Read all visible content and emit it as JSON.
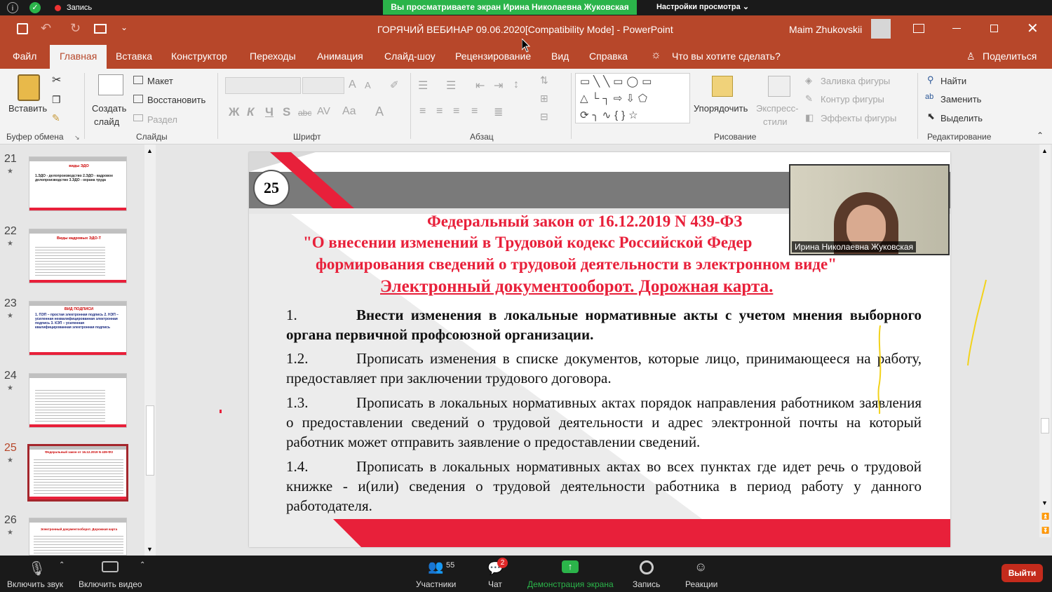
{
  "zoom_top": {
    "recording_label": "Запись",
    "share_banner": "Вы просматриваете экран Ирина Николаевна Жуковская",
    "view_options": "Настройки просмотра"
  },
  "titlebar": {
    "title": "ГОРЯЧИЙ ВЕБИНАР 09.06.2020[Compatibility Mode]  -  PowerPoint",
    "user": "Maim Zhukovskii"
  },
  "tabs": [
    "Файл",
    "Главная",
    "Вставка",
    "Конструктор",
    "Переходы",
    "Анимация",
    "Слайд-шоу",
    "Рецензирование",
    "Вид",
    "Справка"
  ],
  "tell_me": "Что вы хотите сделать?",
  "share": "Поделиться",
  "ribbon": {
    "paste": "Вставить",
    "clipboard_group": "Буфер обмена",
    "new_slide": "Создать",
    "new_slide2": "слайд",
    "layout": "Макет",
    "reset": "Восстановить",
    "section": "Раздел",
    "slides_group": "Слайды",
    "font_group": "Шрифт",
    "paragraph_group": "Абзац",
    "arrange": "Упорядочить",
    "quick_styles": "Экспресс-",
    "quick_styles2": "стили",
    "shape_fill": "Заливка фигуры",
    "shape_outline": "Контур фигуры",
    "shape_effects": "Эффекты фигуры",
    "drawing_group": "Рисование",
    "find": "Найти",
    "replace": "Заменить",
    "select": "Выделить",
    "editing_group": "Редактирование",
    "font_buttons": [
      "Ж",
      "К",
      "Ч",
      "S",
      "abc",
      "AV",
      "Aa",
      "A"
    ]
  },
  "thumbnails": [
    {
      "num": "21",
      "title": "виды ЭДО",
      "body": "1.ЭДО - делопроизводство 2.ЭДО - кадровое делопроизводство 3.ЭДО - охрана труда"
    },
    {
      "num": "22",
      "title": "Виды кадровых ЭДО-Т",
      "body": ""
    },
    {
      "num": "23",
      "title": "ВИД ПОДПИСИ",
      "body": "1. ПЭП – простая электронная подпись 2. НЭП – усиленная неквалифицированная электронная подпись 3. КЭП – усиленная квалифицированная электронная подпись"
    },
    {
      "num": "24",
      "title": "",
      "body": ""
    },
    {
      "num": "25",
      "title": "Федеральный закон от 16.12.2019 N 439-ФЗ",
      "body": ""
    },
    {
      "num": "26",
      "title": "Электронный документооборот. Дорожная карта",
      "body": ""
    }
  ],
  "slide": {
    "number": "25",
    "title1": "Федеральный закон от 16.12.2019 N 439-ФЗ",
    "title2": "\"О внесении изменений в Трудовой кодекс Российской Федер",
    "title3": "формирования сведений о трудовой деятельности в электронном виде\"",
    "title4": "Электронный документооборот. Дорожная карта.",
    "items": [
      {
        "num": "1.",
        "text": "Внести изменения в локальные нормативные акты с учетом мнения выборного органа первичной профсоюзной организации."
      },
      {
        "num": "1.2.",
        "text": "Прописать изменения в списке документов, которые лицо, принимающееся на работу, предоставляет при заключении трудового договора."
      },
      {
        "num": "1.3.",
        "text": "Прописать в локальных нормативных актах порядок направления работником заявления о предоставлении сведений о трудовой деятельности и адрес электронной почты на который работник может отправить заявление о предоставлении сведений."
      },
      {
        "num": "1.4.",
        "text": "Прописать в локальных нормативных актах во всех пунктах где идет речь о трудовой книжке - и(или) сведения о трудовой деятельности работника в период работу у данного работодателя."
      }
    ]
  },
  "webcam_name": "Ирина Николаевна Жуковская",
  "bottom": {
    "mute": "Включить звук",
    "video": "Включить видео",
    "participants": "Участники",
    "participants_count": "55",
    "chat": "Чат",
    "chat_badge": "2",
    "share_screen": "Демонстрация экрана",
    "record": "Запись",
    "reactions": "Реакции",
    "leave": "Выйти"
  },
  "colors": {
    "ppt_red": "#b7472a",
    "zoom_green": "#2bb44a",
    "slide_red": "#e8203a",
    "leave_red": "#c42b1c"
  }
}
